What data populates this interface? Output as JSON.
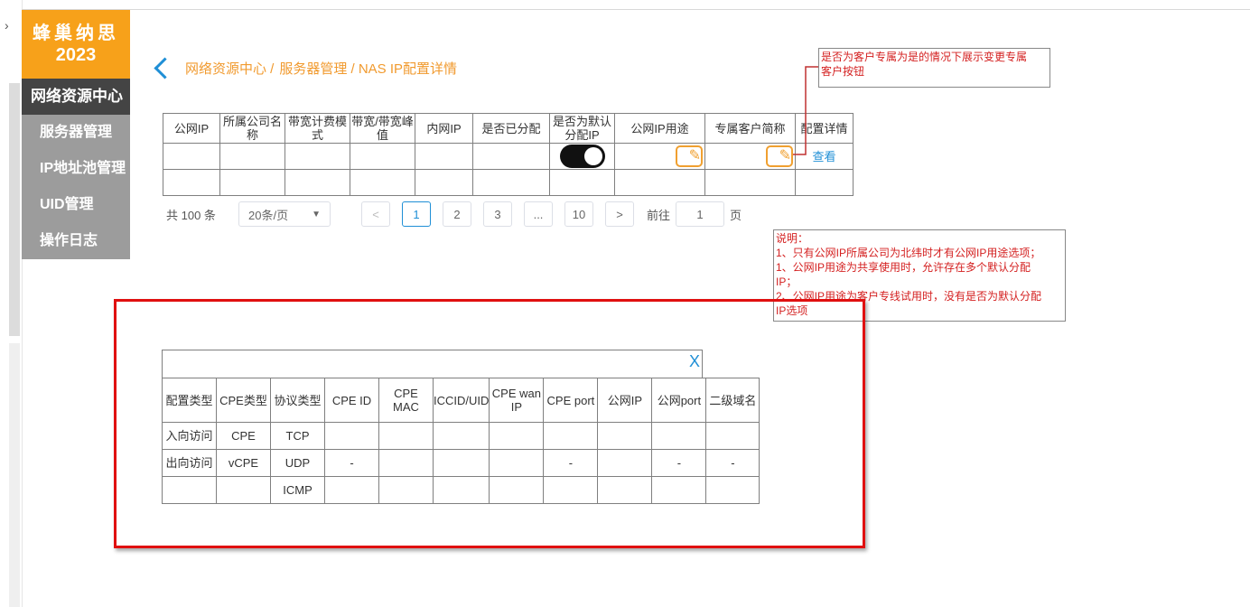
{
  "sidebar": {
    "logo_line1": "蜂巢纳思",
    "logo_line2": "2023",
    "items": [
      "网络资源中心",
      "服务器管理",
      "IP地址池管理",
      "UID管理",
      "操作日志"
    ]
  },
  "breadcrumb": {
    "part1": "网络资源中心 /",
    "part2": "服务器管理 / NAS IP配置详情"
  },
  "main_table": {
    "headers": [
      "公网IP",
      "所属公司名称",
      "带宽计费模式",
      "带宽/带宽峰值",
      "内网IP",
      "是否已分配",
      "是否为默认分配IP",
      "公网IP用途",
      "专属客户简称",
      "配置详情"
    ],
    "view_link": "查看",
    "toggle_on": true
  },
  "pagination": {
    "total": "共 100 条",
    "page_size": "20条/页",
    "pages": [
      "1",
      "2",
      "3",
      "...",
      "10"
    ],
    "current": "1",
    "prev": "<",
    "next": ">",
    "goto_label": "前往",
    "goto_value": "1",
    "goto_suffix": "页"
  },
  "annotations": {
    "note1": [
      "是否为客户专属为是的情况下展示变更专属",
      "客户按钮"
    ],
    "note2": [
      "说明：",
      "1、只有公网IP所属公司为北纬时才有公网IP用途选项；",
      "1、公网IP用途为共享使用时，允许存在多个默认分配",
      "IP；",
      "2、公网IP用途为客户专线试用时，没有是否为默认分配",
      "IP选项"
    ]
  },
  "dialog": {
    "close": "X",
    "headers": [
      "配置类型",
      "CPE类型",
      "协议类型",
      "CPE ID",
      "CPE MAC",
      "ICCID/UID",
      "CPE wan IP",
      "CPE port",
      "公网IP",
      "公网port",
      "二级域名"
    ],
    "rows": [
      [
        "入向访问",
        "CPE",
        "TCP",
        "",
        "",
        "",
        "",
        "",
        "",
        "",
        ""
      ],
      [
        "出向访问",
        "vCPE",
        "UDP",
        "-",
        "",
        "",
        "",
        "-",
        "",
        "-",
        "-"
      ],
      [
        "",
        "",
        "ICMP",
        "",
        "",
        "",
        "",
        "",
        "",
        "",
        ""
      ]
    ]
  },
  "colors": {
    "accent": "#f7a11a",
    "link": "#1f8fd6",
    "annotation": "#d42020",
    "frame": "#e01010"
  }
}
